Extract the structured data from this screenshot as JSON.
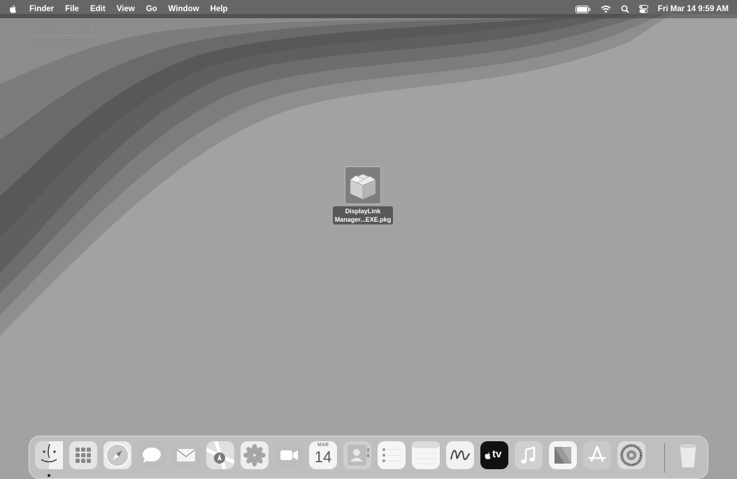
{
  "menubar": {
    "app_name": "Finder",
    "menus": [
      "File",
      "Edit",
      "View",
      "Go",
      "Window",
      "Help"
    ],
    "clock": "Fri Mar 14  9:59 AM",
    "status_icons": [
      "battery-icon",
      "wifi-icon",
      "spotlight-search-icon",
      "control-center-icon"
    ]
  },
  "watermark": "plugable",
  "desktop_file": {
    "line1": "DisplayLink",
    "line2": "Manager...EXE.pkg",
    "icon": "package-icon"
  },
  "dock": {
    "apps": [
      "finder-icon",
      "launchpad-icon",
      "safari-icon",
      "messages-icon",
      "mail-icon",
      "maps-icon",
      "photos-icon",
      "facetime-icon",
      "calendar-icon",
      "contacts-icon",
      "reminders-icon",
      "notes-icon",
      "freeform-icon",
      "apple-tv-icon",
      "music-icon",
      "news-icon",
      "app-store-icon",
      "system-settings-icon",
      "trash-icon"
    ],
    "calendar_month": "MAR",
    "calendar_day": "14",
    "tv_label": "tv"
  }
}
